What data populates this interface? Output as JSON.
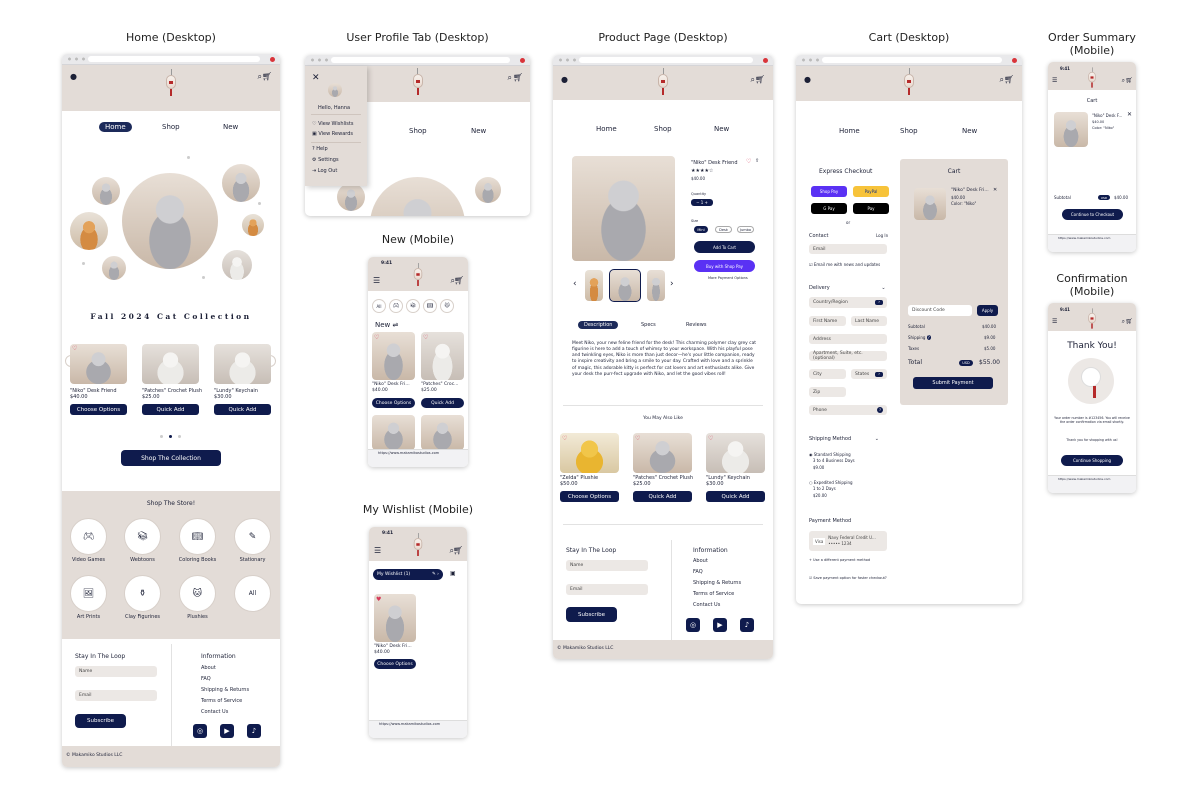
{
  "titles": {
    "home": "Home (Desktop)",
    "profile": "User Profile Tab (Desktop)",
    "product": "Product Page (Desktop)",
    "cart": "Cart (Desktop)",
    "order_summary": "Order Summary (Mobile)",
    "new": "New (Mobile)",
    "wishlist": "My Wishlist (Mobile)",
    "confirmation": "Confirmation (Mobile)"
  },
  "nav": {
    "home": "Home",
    "shop": "Shop",
    "new": "New"
  },
  "home": {
    "collection_title": "Fall 2024 Cat Collection",
    "products": [
      {
        "name": "\"Niko\" Desk Friend",
        "price": "$40.00",
        "button": "Choose Options"
      },
      {
        "name": "\"Patches\" Crochet Plush",
        "price": "$25.00",
        "button": "Quick Add"
      },
      {
        "name": "\"Lundy\" Keychain",
        "price": "$30.00",
        "button": "Quick Add"
      }
    ],
    "shop_collection_button": "Shop The Collection",
    "shop_store_title": "Shop The Store!",
    "categories": [
      "Video Games",
      "Webtoons",
      "Coloring Books",
      "Stationary",
      "Art Prints",
      "Clay Figurines",
      "Plushies",
      "All"
    ]
  },
  "footer": {
    "stay_title": "Stay In The Loop",
    "name_placeholder": "Name",
    "email_placeholder": "Email",
    "subscribe": "Subscribe",
    "info_title": "Information",
    "links": [
      "About",
      "FAQ",
      "Shipping & Returns",
      "Terms of Service",
      "Contact Us"
    ],
    "copyright": "Makamiko Studios LLC"
  },
  "profile": {
    "greeting": "Hello, Hanna",
    "menu": [
      "View Wishlists",
      "View Rewards",
      "Help",
      "Settings",
      "Log Out"
    ]
  },
  "new_mobile": {
    "time": "9:41",
    "heading": "New",
    "items": [
      {
        "name": "\"Niko\" Desk Fri...",
        "price": "$40.00",
        "button": "Choose Options"
      },
      {
        "name": "\"Patches\" Croc...",
        "price": "$25.00",
        "button": "Quick Add"
      }
    ],
    "url": "https://www.makamikostudios.com"
  },
  "wishlist": {
    "time": "9:41",
    "selector": "My Wishlist (1)",
    "item_name": "\"Niko\" Desk Fri...",
    "item_price": "$40.00",
    "item_button": "Choose Options",
    "url": "https://www.makamikostudios.com"
  },
  "product": {
    "name": "\"Niko\" Desk Friend",
    "price": "$40.00",
    "quantity_label": "Quantity",
    "size_label": "Size",
    "sizes": [
      "Mini",
      "Desk",
      "Jumbo"
    ],
    "add_to_cart": "Add To Cart",
    "shop_pay": "Buy with Shop Pay",
    "more_payment": "More Payment Options",
    "tabs": [
      "Description",
      "Specs",
      "Reviews"
    ],
    "description": "Meet Niko, your new feline friend for the desk! This charming polymer clay grey cat figurine is here to add a touch of whimsy to your workspace. With his playful pose and twinkling eyes, Niko is more than just decor—he's your little companion, ready to inspire creativity and bring a smile to your day. Crafted with love and a sprinkle of magic, this adorable kitty is perfect for cat lovers and art enthusiasts alike. Give your desk the purr-fect upgrade with Niko, and let the good vibes roll!",
    "also_like_title": "You May Also Like",
    "also_like": [
      {
        "name": "\"Zelda\" Plushie",
        "price": "$50.00",
        "button": "Choose Options"
      },
      {
        "name": "\"Patches\" Crochet Plush",
        "price": "$25.00",
        "button": "Quick Add"
      },
      {
        "name": "\"Lundy\" Keychain",
        "price": "$30.00",
        "button": "Quick Add"
      }
    ]
  },
  "cart": {
    "express_title": "Express Checkout",
    "express_buttons": [
      "Shop Pay",
      "PayPal",
      "G Pay",
      "Pay"
    ],
    "or": "or",
    "contact": "Contact",
    "login": "Log In",
    "email": "Email",
    "email_news": "Email me with news and updates",
    "delivery": "Delivery",
    "country": "Country/Region",
    "first_name": "First Name",
    "last_name": "Last Name",
    "address": "Address",
    "apartment": "Apartment, Suite, etc. (optional)",
    "city": "City",
    "state": "States",
    "zip": "Zip",
    "phone": "Phone",
    "shipping_method": "Shipping Method",
    "standard": "Standard Shipping",
    "standard_days": "3 to 4 Business Days",
    "standard_price": "$9.00",
    "expedited": "Expedited Shipping",
    "expedited_days": "1 to 2 Days",
    "expedited_price": "$20.00",
    "payment_method": "Payment Method",
    "card": "Navy Federal Credit U...",
    "card_num": "••••• 1234",
    "card_brand": "Visa",
    "different": "Use a different payment method",
    "save": "Save payment option for faster checkout?",
    "cart_title": "Cart",
    "item_name": "\"Niko\" Desk Fri...",
    "item_price": "$40.00",
    "item_color": "Color: \"Niko\"",
    "discount": "Discount Code",
    "apply": "Apply",
    "subtotal": "Subtotal",
    "subtotal_val": "$40.00",
    "shipping": "Shipping",
    "shipping_val": "$9.00",
    "taxes": "Taxes",
    "taxes_val": "$5.00",
    "total": "Total",
    "currency": "USD",
    "total_val": "$55.00",
    "submit": "Submit Payment"
  },
  "order_summary": {
    "time": "9:41",
    "cart_title": "Cart",
    "item_name": "\"Niko\" Desk F...",
    "item_price": "$40.00",
    "item_color": "Color: \"Niko\"",
    "subtotal": "Subtotal",
    "currency": "USD",
    "subtotal_val": "$40.00",
    "checkout": "Continue to Checkout",
    "url": "https://www.makamikostudios.com"
  },
  "confirmation": {
    "time": "9:41",
    "thank_you": "Thank You!",
    "order_text": "Your order number is #123456. You will receive the order confirmation via email shortly.",
    "thanks_text": "Thank you for shopping with us!",
    "continue": "Continue Shopping",
    "url": "https://www.makamikostudios.com"
  },
  "colors": {
    "navy": "#0f1b4d",
    "tan": "#e3dcd7",
    "heart": "#d63a5a"
  },
  "icons": [
    "user-icon",
    "search-icon",
    "cart-icon",
    "heart-icon",
    "close-icon",
    "chevron-left-icon",
    "chevron-right-icon",
    "hamburger-icon",
    "instagram-icon",
    "youtube-icon",
    "tiktok-icon"
  ]
}
